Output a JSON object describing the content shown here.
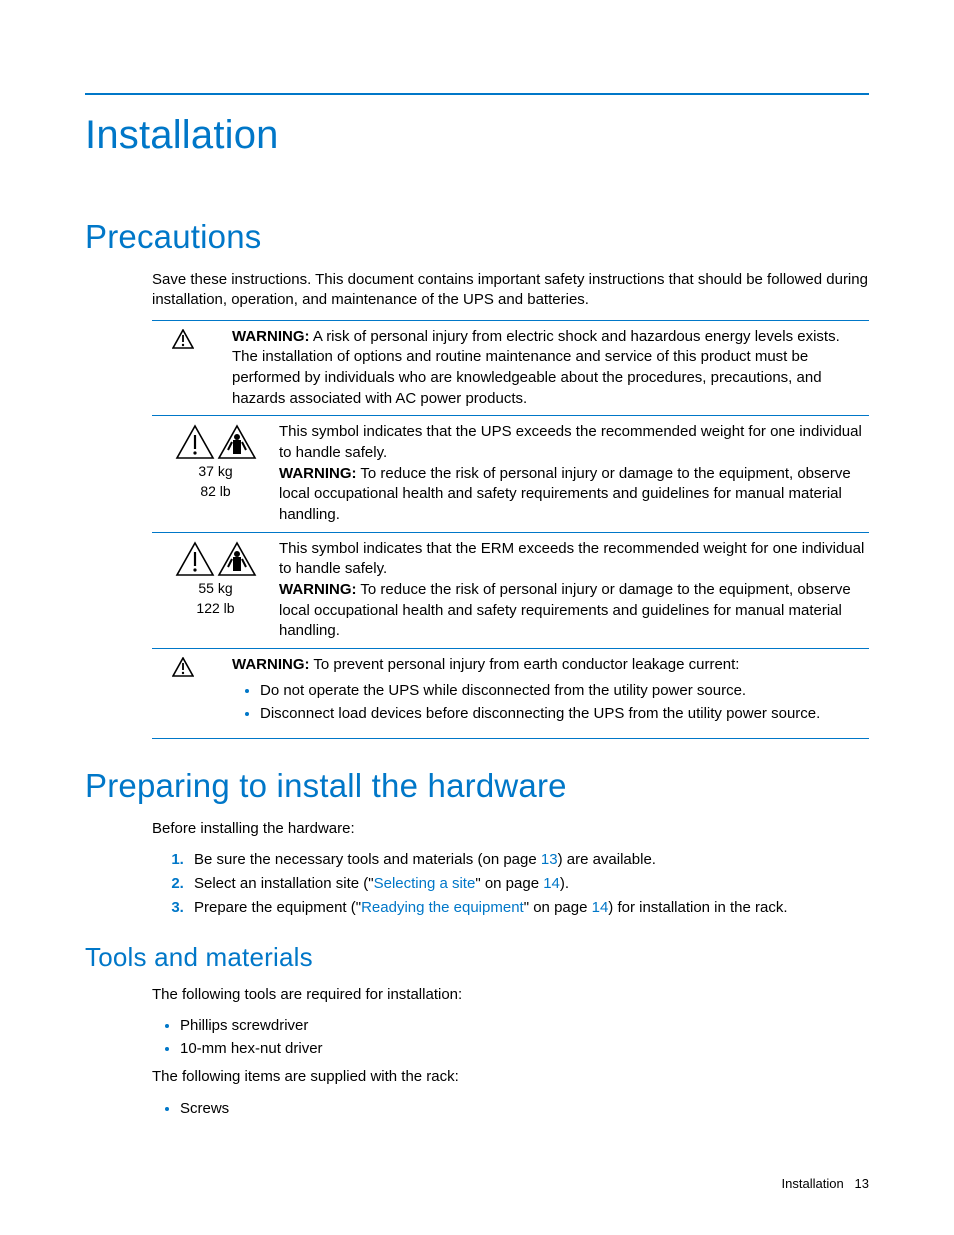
{
  "title": "Installation",
  "precautions": {
    "heading": "Precautions",
    "intro": "Save these instructions. This document contains important safety instructions that should be followed during installation, operation, and maintenance of the UPS and batteries.",
    "warnings": [
      {
        "icon_type": "triangle",
        "weight_kg": null,
        "weight_lb": null,
        "pre_text": null,
        "label": "WARNING:",
        "text": "A risk of personal injury from electric shock and hazardous energy levels exists. The installation of options and routine maintenance and service of this product must be performed by individuals who are knowledgeable about the procedures, precautions, and hazards associated with AC power products.",
        "bullets": null
      },
      {
        "icon_type": "weight",
        "weight_kg": "37 kg",
        "weight_lb": "82 lb",
        "pre_text": "This symbol indicates that the UPS exceeds the recommended weight for one individual to handle safely.",
        "label": "WARNING:",
        "text": "To reduce the risk of personal injury or damage to the equipment, observe local occupational health and safety requirements and guidelines for manual material handling.",
        "bullets": null
      },
      {
        "icon_type": "weight",
        "weight_kg": "55 kg",
        "weight_lb": "122 lb",
        "pre_text": "This symbol indicates that the ERM exceeds the recommended weight for one individual to handle safely.",
        "label": "WARNING:",
        "text": "To reduce the risk of personal injury or damage to the equipment, observe local occupational health and safety requirements and guidelines for manual material handling.",
        "bullets": null
      },
      {
        "icon_type": "triangle",
        "weight_kg": null,
        "weight_lb": null,
        "pre_text": null,
        "label": "WARNING:",
        "text": "To prevent personal injury from earth conductor leakage current:",
        "bullets": [
          "Do not operate the UPS while disconnected from the utility power source.",
          "Disconnect load devices before disconnecting the UPS from the utility power source."
        ]
      }
    ]
  },
  "preparing": {
    "heading": "Preparing to install the hardware",
    "intro": "Before installing the hardware:",
    "steps": [
      {
        "prefix": "Be sure the necessary tools and materials (on page ",
        "link": "13",
        "suffix": ") are available."
      },
      {
        "prefix": "Select an installation site (\"",
        "link": "Selecting a site",
        "mid": "\" on page ",
        "link2": "14",
        "suffix": ")."
      },
      {
        "prefix": "Prepare the equipment (\"",
        "link": "Readying the equipment",
        "mid": "\" on page ",
        "link2": "14",
        "suffix": ") for installation in the rack."
      }
    ]
  },
  "tools": {
    "heading": "Tools and materials",
    "required_intro": "The following tools are required for installation:",
    "required_items": [
      "Phillips screwdriver",
      "10-mm hex-nut driver"
    ],
    "supplied_intro": "The following items are supplied with the rack:",
    "supplied_items": [
      "Screws"
    ]
  },
  "footer": {
    "section": "Installation",
    "page": "13"
  }
}
